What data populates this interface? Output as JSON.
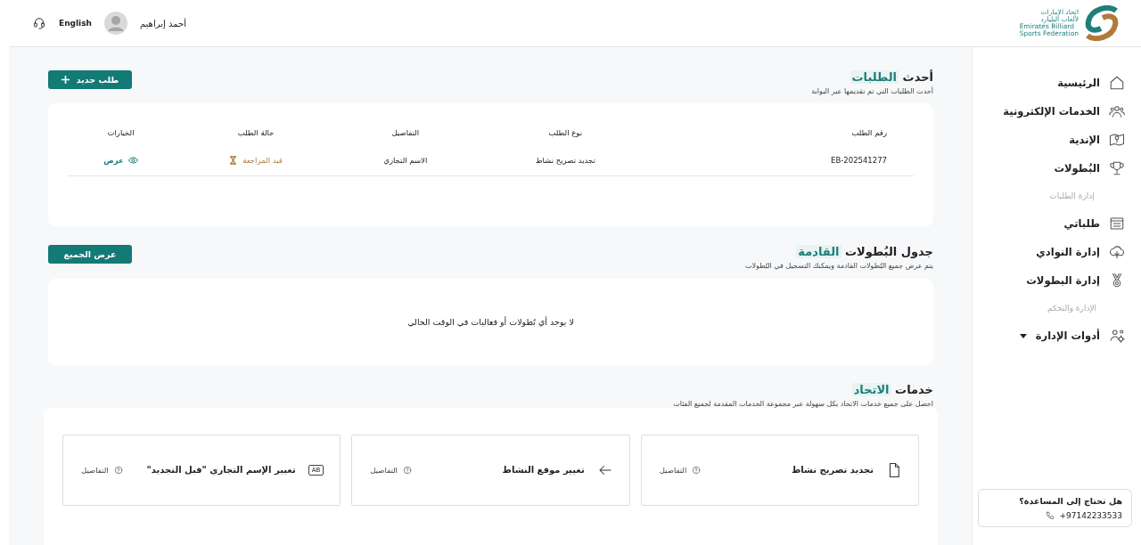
{
  "header": {
    "user_name": "أحمد إبراهيم",
    "language": "English",
    "logo": {
      "arabic_lines": [
        "اتحاد الإمارات",
        "لألعاب البليارد"
      ],
      "english_lines": [
        "Emirates Billiard",
        "Sports Federation"
      ]
    }
  },
  "sidebar": {
    "items": [
      {
        "kind": "link",
        "label": "الرئيسية"
      },
      {
        "kind": "link",
        "label": "الخدمات الإلكترونية"
      },
      {
        "kind": "link",
        "label": "الإندية"
      },
      {
        "kind": "link",
        "label": "البُطولات"
      },
      {
        "kind": "heading",
        "label": "إدارة الطلبات"
      },
      {
        "kind": "link",
        "label": "طلباتي"
      },
      {
        "kind": "link",
        "label": "إدارة النوادي"
      },
      {
        "kind": "link",
        "label": "إدارة البطولات"
      },
      {
        "kind": "heading",
        "label": "الإدارة والتحكم"
      },
      {
        "kind": "dropdown",
        "label": "أدوات الإدارة",
        "expanded": false
      }
    ],
    "help": {
      "title": "هل تحتاج إلى المساعدة؟",
      "phone": "+97142233533"
    }
  },
  "requests": {
    "title": "أحدث",
    "title_highlight": "الطلبات",
    "subtitle": "أحدث الطلبات التي تم تقديمها عبر البوابة",
    "new_button": "طلب جديد",
    "table": {
      "columns": [
        "رقم الطلب",
        "نوع الطلب",
        "التفاصيل",
        "حالة الطلب",
        "الخيارات"
      ],
      "rows": [
        {
          "number": "EB-202541277",
          "type": "تجديد تصريح نشاط",
          "details": "الاسم التجاري",
          "status": "قيد المراجعة",
          "action": "عرض"
        }
      ]
    }
  },
  "tournaments": {
    "title": "جدول البُطولات",
    "title_highlight": "القادمة",
    "subtitle": "يتم عرض جميع البُطولات القادمة ويمكنك التسجيل في البُطولات",
    "view_all_button": "عرض الجميع",
    "empty_message": "لا يوجد أي بُطولات أو فعاليات في الوقت الحالي"
  },
  "services": {
    "title": "خدمات",
    "title_highlight": "الاتحاد",
    "subtitle": "احصل على جميع خدمات الاتحاد بكل سهولة عبر مجموعة الخدمات المقدمة لجميع الفئات",
    "cards": [
      {
        "title": "تجديد تصريح نشاط",
        "details": "التفاصيل"
      },
      {
        "title": "تغيير موقع النشاط",
        "details": "التفاصيل"
      },
      {
        "title": "تغيير الإسم التجاري \"قبل التجديد\"",
        "icon_text": "AB",
        "details": "التفاصيل"
      }
    ]
  }
}
